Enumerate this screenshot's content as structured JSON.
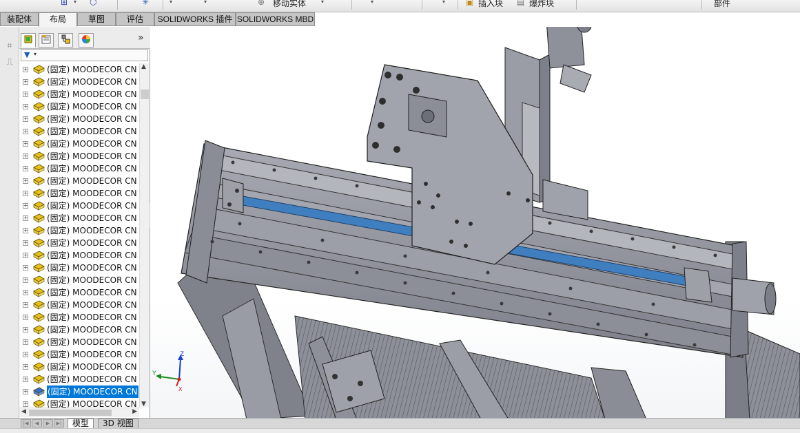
{
  "toolbar_partial": {
    "move_body_label": "移动实体",
    "insert_block_label": "插入块",
    "explode_label": "爆炸块",
    "part_label": "部件"
  },
  "command_tabs": [
    {
      "label": "装配体",
      "active": false
    },
    {
      "label": "布局",
      "active": true
    },
    {
      "label": "草图",
      "active": false
    },
    {
      "label": "评估",
      "active": false
    },
    {
      "label": "SOLIDWORKS 插件",
      "active": false
    },
    {
      "label": "SOLIDWORKS MBD",
      "active": false
    }
  ],
  "feature_manager": {
    "overflow_glyph": "»",
    "tree_items": [
      {
        "prefix": "(固定)",
        "name": "MOODECOR CN",
        "selected": false
      },
      {
        "prefix": "(固定)",
        "name": "MOODECOR CN",
        "selected": false
      },
      {
        "prefix": "(固定)",
        "name": "MOODECOR CN",
        "selected": false
      },
      {
        "prefix": "(固定)",
        "name": "MOODECOR CN",
        "selected": false
      },
      {
        "prefix": "(固定)",
        "name": "MOODECOR CN",
        "selected": false
      },
      {
        "prefix": "(固定)",
        "name": "MOODECOR CN",
        "selected": false
      },
      {
        "prefix": "(固定)",
        "name": "MOODECOR CN",
        "selected": false
      },
      {
        "prefix": "(固定)",
        "name": "MOODECOR CN",
        "selected": false
      },
      {
        "prefix": "(固定)",
        "name": "MOODECOR CN",
        "selected": false
      },
      {
        "prefix": "(固定)",
        "name": "MOODECOR CN",
        "selected": false
      },
      {
        "prefix": "(固定)",
        "name": "MOODECOR CN",
        "selected": false
      },
      {
        "prefix": "(固定)",
        "name": "MOODECOR CN",
        "selected": false
      },
      {
        "prefix": "(固定)",
        "name": "MOODECOR CN",
        "selected": false
      },
      {
        "prefix": "(固定)",
        "name": "MOODECOR CN",
        "selected": false
      },
      {
        "prefix": "(固定)",
        "name": "MOODECOR CN",
        "selected": false
      },
      {
        "prefix": "(固定)",
        "name": "MOODECOR CN",
        "selected": false
      },
      {
        "prefix": "(固定)",
        "name": "MOODECOR CN",
        "selected": false
      },
      {
        "prefix": "(固定)",
        "name": "MOODECOR CN",
        "selected": false
      },
      {
        "prefix": "(固定)",
        "name": "MOODECOR CN",
        "selected": false
      },
      {
        "prefix": "(固定)",
        "name": "MOODECOR CN",
        "selected": false
      },
      {
        "prefix": "(固定)",
        "name": "MOODECOR CN",
        "selected": false
      },
      {
        "prefix": "(固定)",
        "name": "MOODECOR CN",
        "selected": false
      },
      {
        "prefix": "(固定)",
        "name": "MOODECOR CN",
        "selected": false
      },
      {
        "prefix": "(固定)",
        "name": "MOODECOR CN",
        "selected": false
      },
      {
        "prefix": "(固定)",
        "name": "MOODECOR CN",
        "selected": false
      },
      {
        "prefix": "(固定)",
        "name": "MOODECOR CN",
        "selected": false
      },
      {
        "prefix": "(固定)",
        "name": "MOODECOR CN",
        "selected": true
      },
      {
        "prefix": "(固定)",
        "name": "MOODECOR CN",
        "selected": false
      }
    ]
  },
  "triad": {
    "x": "X",
    "y": "Y",
    "z": "Z"
  },
  "bottom_tabs": [
    {
      "label": "模型",
      "active": true
    },
    {
      "label": "3D 视图",
      "active": false
    }
  ],
  "colors": {
    "part_icon_yellow": "#e8c21a",
    "selected_bg": "#0078d7",
    "model_gray": "#8f929c",
    "rail_blue": "#3f7fc0"
  }
}
